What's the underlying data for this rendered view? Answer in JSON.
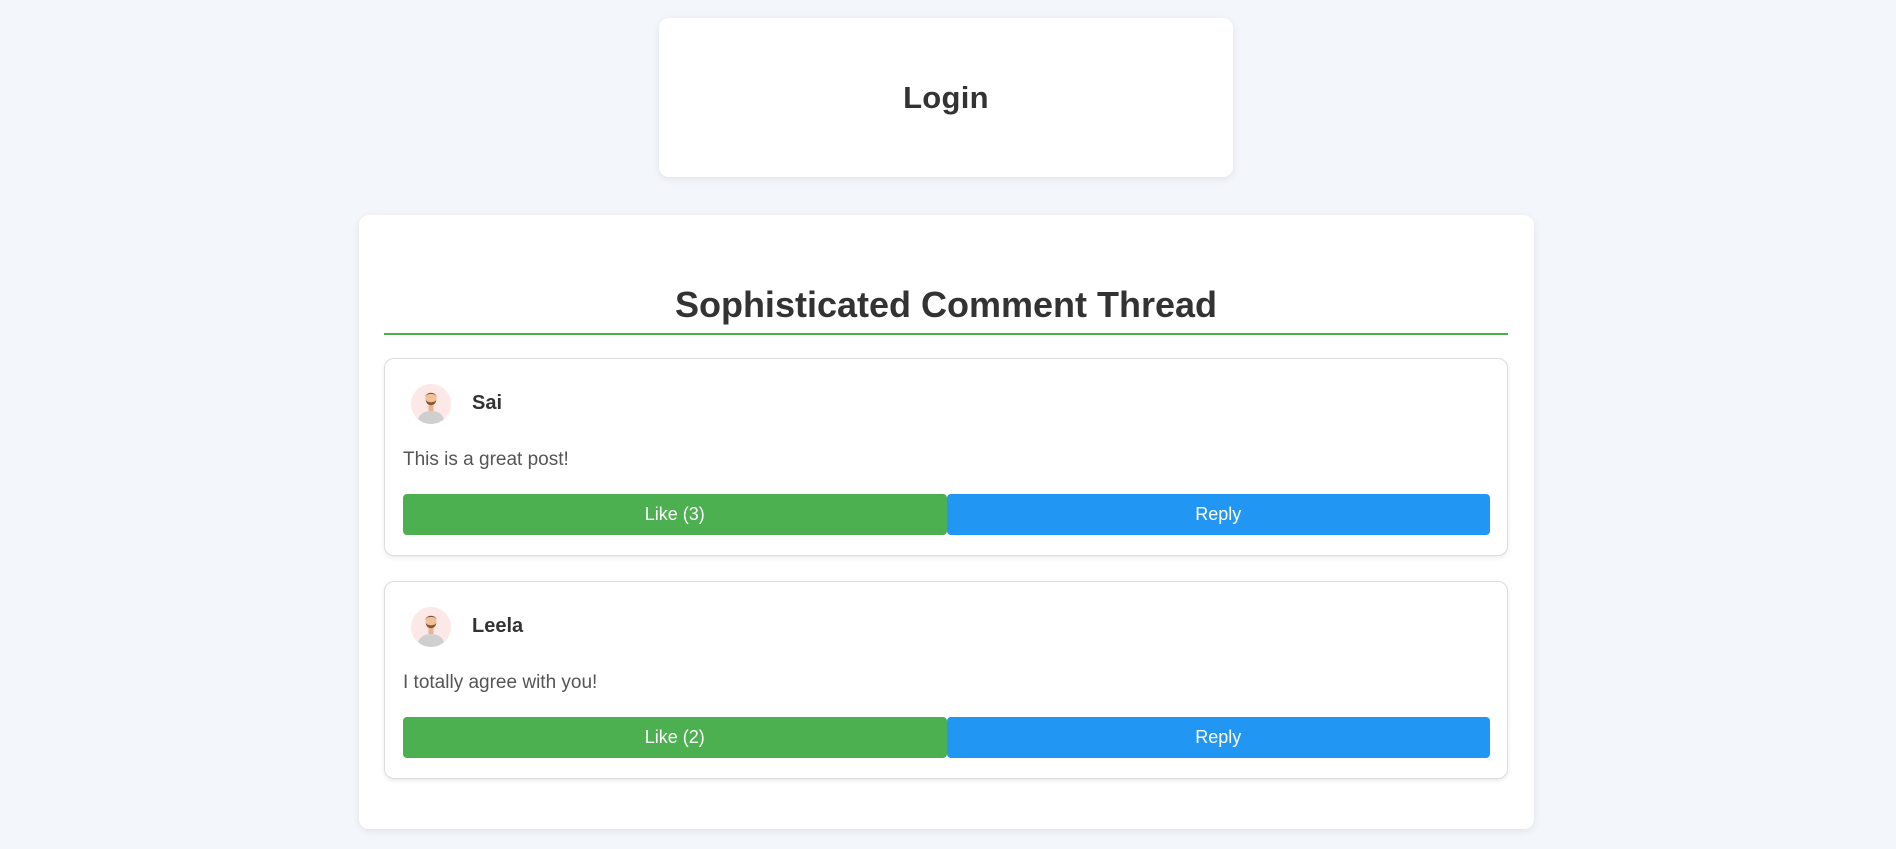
{
  "login": {
    "title": "Login"
  },
  "thread": {
    "title": "Sophisticated Comment Thread",
    "comments": [
      {
        "username": "Sai",
        "text": "This is a great post!",
        "like_label": "Like (3)",
        "reply_label": "Reply"
      },
      {
        "username": "Leela",
        "text": "I totally agree with you!",
        "like_label": "Like (2)",
        "reply_label": "Reply"
      }
    ]
  },
  "colors": {
    "background": "#f3f6fb",
    "accent_green": "#4caf50",
    "accent_blue": "#2196f3",
    "avatar_bg": "#fde8e8"
  },
  "icons": {
    "avatar": "user-avatar-icon"
  }
}
